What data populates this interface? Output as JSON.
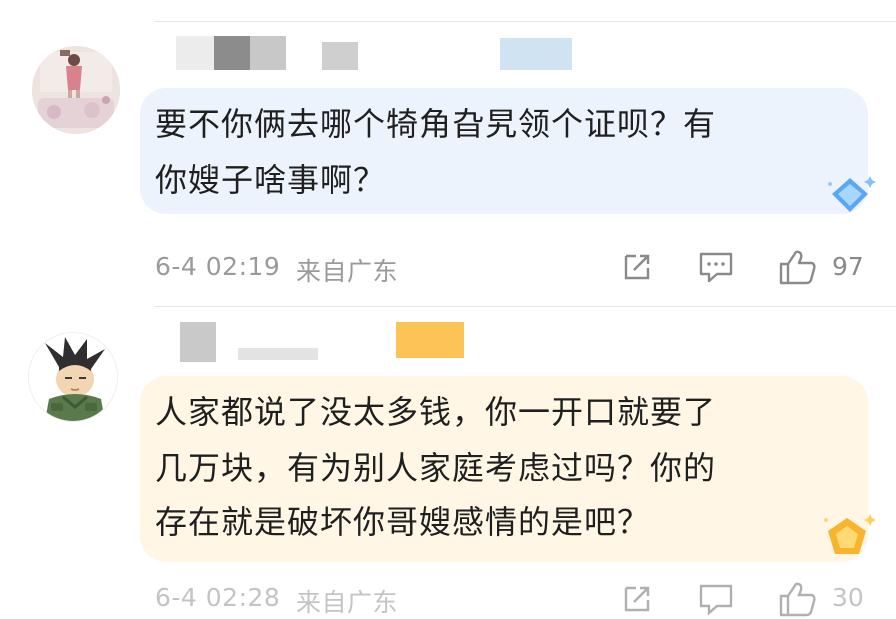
{
  "comments": [
    {
      "text_lines": [
        "要不你俩去哪个犄角旮旯领个证呗？有",
        "你嫂子啥事啊？"
      ],
      "date": "6-4 02:19",
      "location": "来自广东",
      "like_count": "97",
      "avatar_icon": "avatar-photo",
      "badge_icon": "blue-diamond-badge",
      "bubble_color": "#e9f1fd"
    },
    {
      "text_lines": [
        "人家都说了没太多钱，你一开口就要了",
        "几万块，有为别人家庭考虑过吗？你的",
        "存在就是破坏你哥嫂感情的是吧？"
      ],
      "date": "6-4 02:28",
      "location": "来自广东",
      "like_count": "30",
      "avatar_icon": "cartoon-avatar",
      "badge_icon": "gold-pentagon-badge",
      "bubble_color": "#fff4e0"
    }
  ],
  "icons": {
    "share": "share-icon",
    "reply": "comment-icon",
    "like": "thumbs-up-icon"
  }
}
